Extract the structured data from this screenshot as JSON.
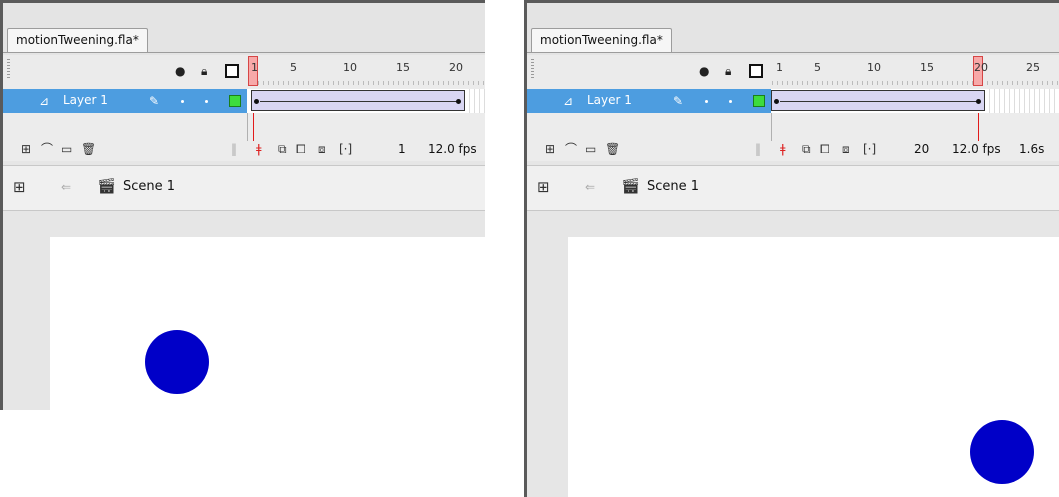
{
  "panels": [
    {
      "tab_title": "motionTweening.fla*",
      "ruler_labels": [
        "1",
        "5",
        "10",
        "15",
        "20"
      ],
      "current_frame_label": "1",
      "layer_name": "Layer 1",
      "footer": {
        "frame": "1",
        "fps": "12.0 fps",
        "time": ""
      },
      "scene_label": "Scene 1",
      "colors": {
        "circle": "#0000c8",
        "layer_selected": "#4d9de0",
        "tween_fill": "#d9d6f3"
      }
    },
    {
      "tab_title": "motionTweening.fla*",
      "ruler_labels": [
        "1",
        "5",
        "10",
        "15",
        "20",
        "25"
      ],
      "current_frame_label": "20",
      "layer_name": "Layer 1",
      "footer": {
        "frame": "20",
        "fps": "12.0 fps",
        "time": "1.6s"
      },
      "scene_label": "Scene 1",
      "colors": {
        "circle": "#0000c8",
        "layer_selected": "#4d9de0",
        "tween_fill": "#d9d6f3"
      }
    }
  ],
  "icons": {
    "eye": "eye-icon",
    "lock": "lock-icon",
    "outline": "outline-square-icon",
    "layer": "layer-icon",
    "pencil": "pencil-icon",
    "new_layer": "new-layer-icon",
    "motion_guide": "motion-guide-icon",
    "folder": "folder-icon",
    "trash": "trash-icon",
    "center_frame": "center-frame-icon",
    "onion_skin": "onion-skin-icon",
    "onion_outlines": "onion-outlines-icon",
    "edit_multiple": "edit-multiple-frames-icon",
    "modify_markers": "modify-markers-icon",
    "timeline_toggle": "timeline-icon",
    "back_arrow": "back-arrow-icon",
    "scene_clapper": "scene-clapper-icon"
  }
}
